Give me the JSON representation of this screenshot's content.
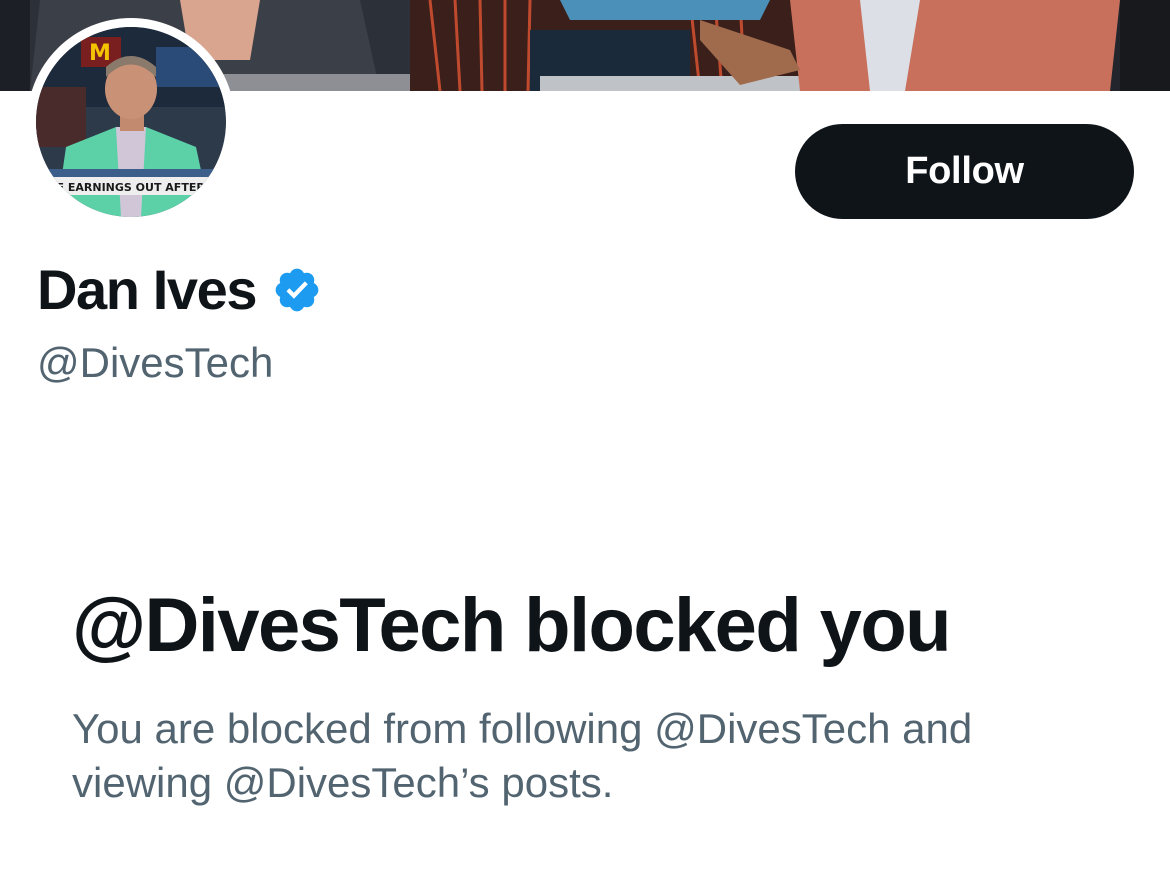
{
  "profile": {
    "display_name": "Dan Ives",
    "handle": "@DivesTech",
    "verified_icon": "verified-badge-icon",
    "verified_color": "#1d9bf0",
    "avatar_ticker_text": "RCE EARNINGS OUT AFTER",
    "avatar_logo_text": "M"
  },
  "actions": {
    "follow_label": "Follow"
  },
  "blocked": {
    "title": "@DivesTech blocked you",
    "description": "You are blocked from following @DivesTech and viewing @DivesTech’s posts."
  },
  "colors": {
    "primary_text": "#0f1419",
    "secondary_text": "#536471",
    "button_bg": "#0f1419",
    "button_text": "#ffffff",
    "background": "#ffffff"
  }
}
